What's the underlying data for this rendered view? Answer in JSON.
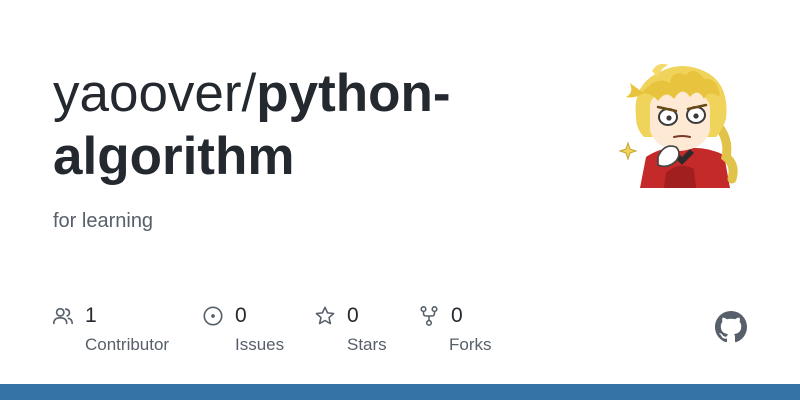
{
  "repo": {
    "owner": "yaoover/",
    "name": "python-algorithm",
    "description": "for learning"
  },
  "avatar": {
    "alt_name": "owner-avatar"
  },
  "stats": [
    {
      "icon": "people-icon",
      "count": "1",
      "label": "Contributor"
    },
    {
      "icon": "issue-opened-icon",
      "count": "0",
      "label": "Issues"
    },
    {
      "icon": "star-icon",
      "count": "0",
      "label": "Stars"
    },
    {
      "icon": "repo-forked-icon",
      "count": "0",
      "label": "Forks"
    }
  ],
  "logo": {
    "icon": "github-mark-icon"
  },
  "colors": {
    "title": "#24292f",
    "muted": "#57606a",
    "icon": "#57606a",
    "bottom_bar": "#3572a5"
  }
}
